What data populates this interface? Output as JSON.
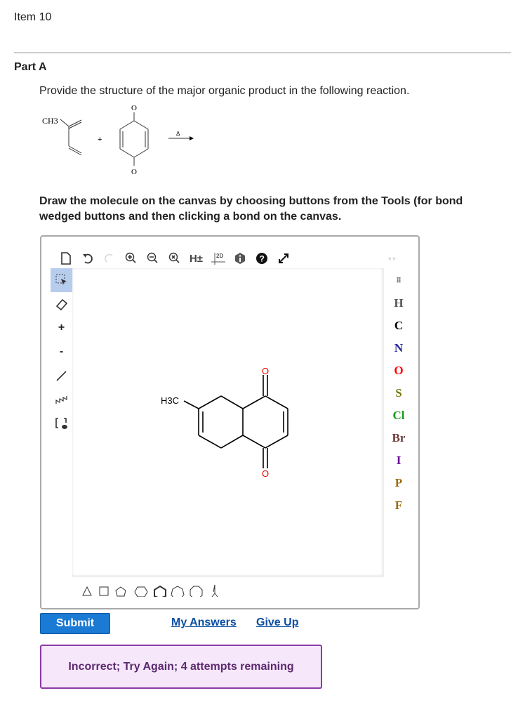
{
  "item_title": "Item 10",
  "part_title": "Part A",
  "question": "Provide the structure of the major organic product in the following reaction.",
  "reaction": {
    "reactant1_label": "CH3",
    "plus": "+",
    "o_top": "O",
    "o_bottom": "O",
    "arrow_label": "Δ"
  },
  "instruction_line1": "Draw the molecule on the canvas by choosing buttons from the Tools (for bond",
  "instruction_line2": "wedged buttons and then clicking a bond on the canvas.",
  "toolbar": {
    "h_toggle": "H±",
    "clean2d": "2D"
  },
  "left_tools": {
    "plus": "+",
    "minus": "-"
  },
  "atoms": [
    {
      "s": "H",
      "c": "#555555"
    },
    {
      "s": "C",
      "c": "#000000"
    },
    {
      "s": "N",
      "c": "#2a2a9a"
    },
    {
      "s": "O",
      "c": "#ff0000"
    },
    {
      "s": "S",
      "c": "#7a7a10"
    },
    {
      "s": "Cl",
      "c": "#1a9a1a"
    },
    {
      "s": "Br",
      "c": "#6b3a3a"
    },
    {
      "s": "I",
      "c": "#6a0a9a"
    },
    {
      "s": "P",
      "c": "#a06a10"
    },
    {
      "s": "F",
      "c": "#a06a10"
    }
  ],
  "canvas": {
    "methyl_label": "H3C",
    "o_label": "O"
  },
  "buttons": {
    "submit": "Submit",
    "my_answers": "My Answers",
    "give_up": "Give Up"
  },
  "feedback": "Incorrect; Try Again; 4 attempts remaining"
}
